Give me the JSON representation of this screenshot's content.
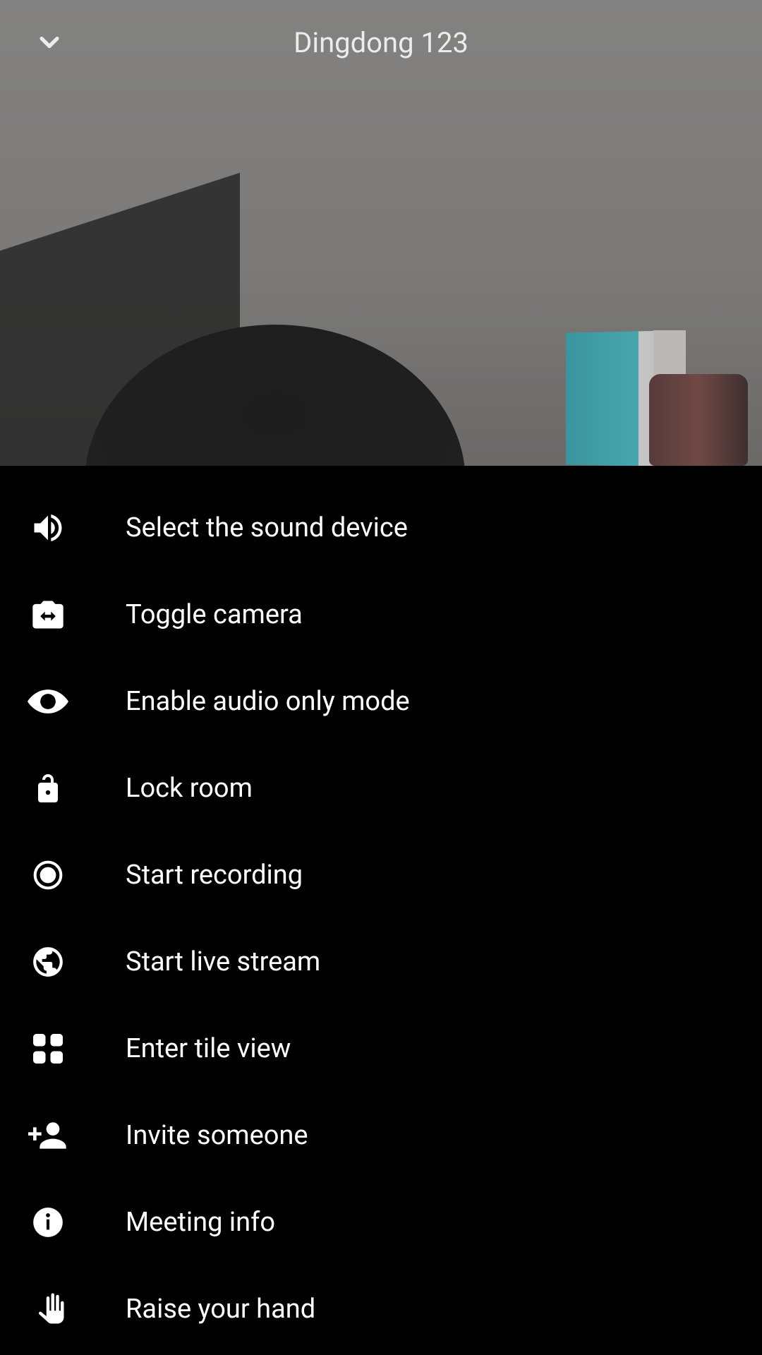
{
  "header": {
    "title": "Dingdong 123"
  },
  "menu": {
    "items": [
      {
        "icon": "volume-icon",
        "label": "Select the sound device"
      },
      {
        "icon": "camera-switch-icon",
        "label": "Toggle camera"
      },
      {
        "icon": "eye-icon",
        "label": "Enable audio only mode"
      },
      {
        "icon": "unlock-icon",
        "label": "Lock room"
      },
      {
        "icon": "record-icon",
        "label": "Start recording"
      },
      {
        "icon": "globe-icon",
        "label": "Start live stream"
      },
      {
        "icon": "tile-view-icon",
        "label": "Enter tile view"
      },
      {
        "icon": "person-add-icon",
        "label": "Invite someone"
      },
      {
        "icon": "info-icon",
        "label": "Meeting info"
      },
      {
        "icon": "hand-icon",
        "label": "Raise your hand"
      }
    ]
  }
}
